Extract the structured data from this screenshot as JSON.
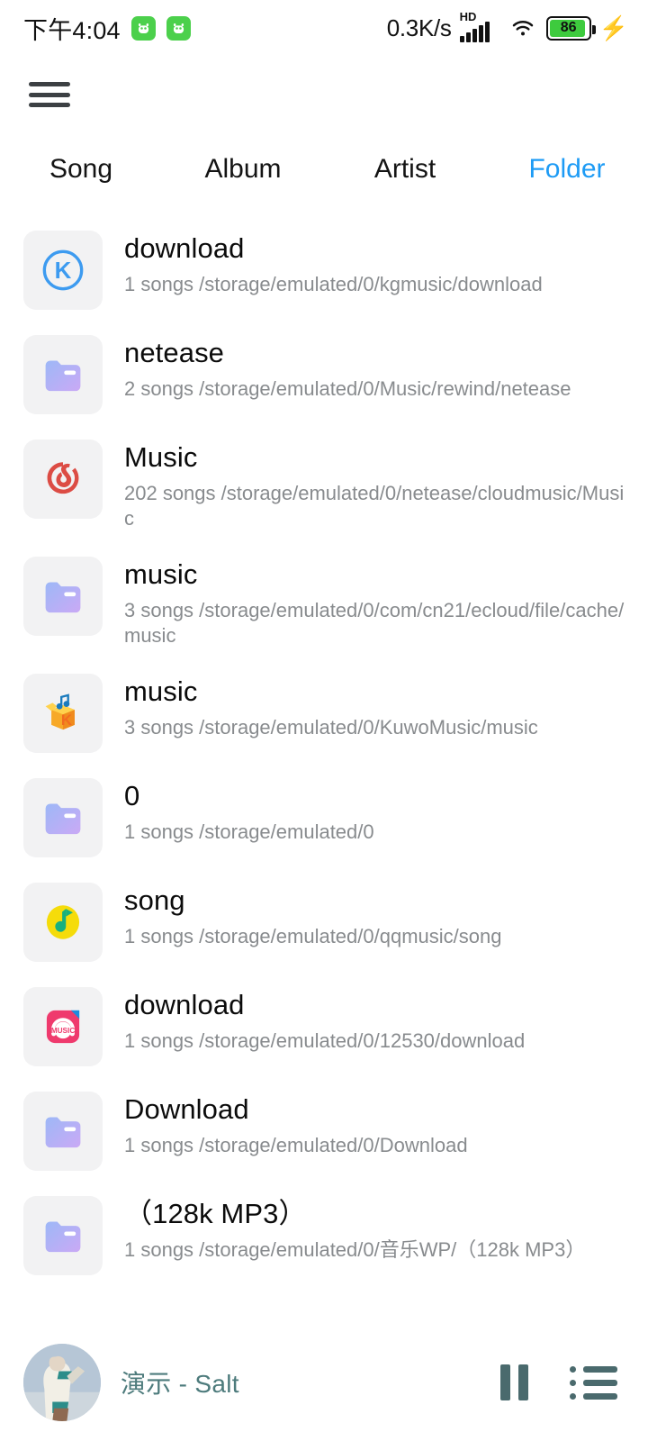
{
  "status_bar": {
    "time": "下午4:04",
    "notification_icons": [
      "app-notification-icon",
      "app-notification-icon"
    ],
    "network_speed": "0.3K/s",
    "signal_label": "HD",
    "signal_icon": "cellular-signal-icon",
    "wifi_icon": "wifi-icon",
    "battery_percent": "86",
    "charging_icon": "charging-bolt-icon"
  },
  "app_bar": {
    "menu_icon": "hamburger-menu-icon"
  },
  "tabs": {
    "active_color": "#1d9bf5",
    "items": [
      {
        "label": "Song",
        "active": false
      },
      {
        "label": "Album",
        "active": false
      },
      {
        "label": "Artist",
        "active": false
      },
      {
        "label": "Folder",
        "active": true
      }
    ]
  },
  "folders": [
    {
      "icon": "kugou-music-icon",
      "name": "download",
      "meta": "1 songs /storage/emulated/0/kgmusic/download"
    },
    {
      "icon": "folder-icon",
      "name": "netease",
      "meta": "2 songs /storage/emulated/0/Music/rewind/netease"
    },
    {
      "icon": "netease-music-icon",
      "name": "Music",
      "meta": "202 songs /storage/emulated/0/netease/cloudmusic/Music"
    },
    {
      "icon": "folder-icon",
      "name": "music",
      "meta": "3 songs /storage/emulated/0/com/cn21/ecloud/file/cache/music"
    },
    {
      "icon": "kuwo-music-icon",
      "name": "music",
      "meta": "3 songs /storage/emulated/0/KuwoMusic/music"
    },
    {
      "icon": "folder-icon",
      "name": "0",
      "meta": "1 songs /storage/emulated/0"
    },
    {
      "icon": "qq-music-icon",
      "name": "song",
      "meta": "1 songs /storage/emulated/0/qqmusic/song"
    },
    {
      "icon": "migu-music-icon",
      "name": "download",
      "meta": "1 songs /storage/emulated/0/12530/download"
    },
    {
      "icon": "folder-icon",
      "name": "Download",
      "meta": "1 songs /storage/emulated/0/Download"
    },
    {
      "icon": "folder-icon",
      "name": "（128k MP3）",
      "meta": "1 songs /storage/emulated/0/音乐WP/（128k MP3）"
    }
  ],
  "player": {
    "album_art": "album-art-thumbnail",
    "now_playing": "演示 - Salt",
    "pause_icon": "pause-icon",
    "playlist_icon": "playlist-icon",
    "text_color": "#4d7b7c"
  }
}
